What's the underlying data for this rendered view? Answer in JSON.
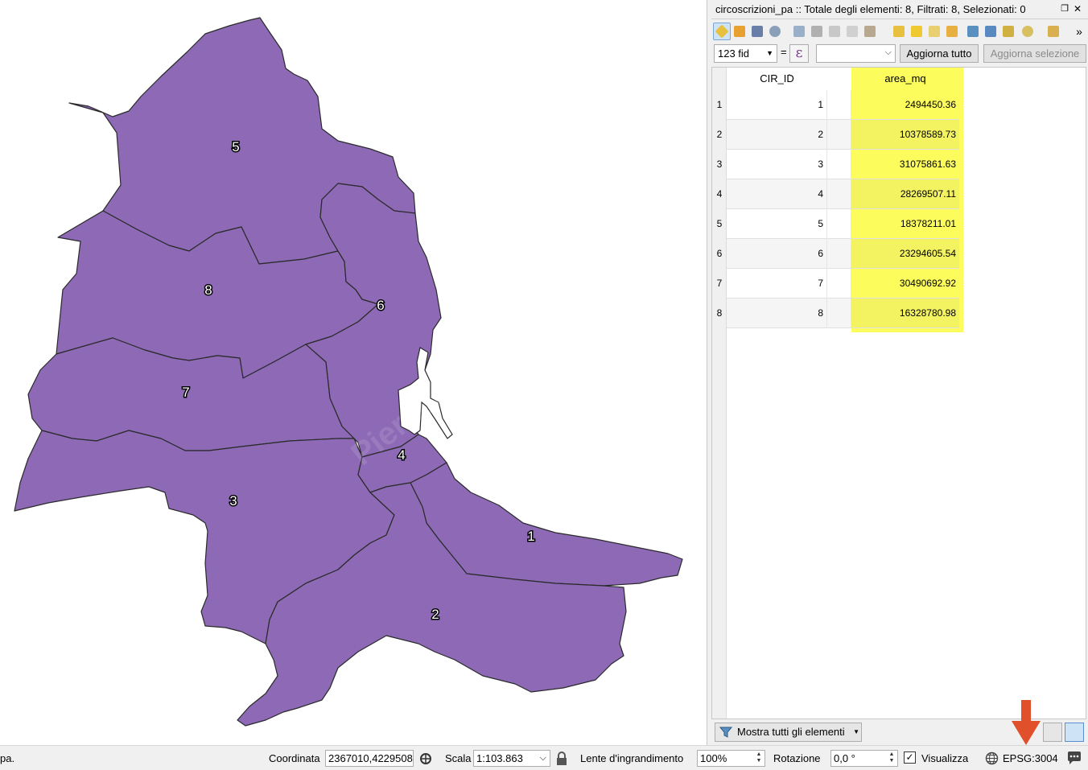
{
  "map": {
    "fill_color": "#8d69b6",
    "stroke_color": "#2a2a2a",
    "labels": [
      "1",
      "2",
      "3",
      "4",
      "5",
      "6",
      "7",
      "8"
    ],
    "watermark": "Pierecoinfinito"
  },
  "attribute_table": {
    "title": "circoscrizioni_pa :: Totale degli elementi: 8, Filtrati: 8, Selezionati: 0",
    "toolbar_icons": [
      "pencil-icon",
      "multi-edit-icon",
      "save-icon",
      "reload-icon",
      "add-feature-icon",
      "delete-icon",
      "cut-icon",
      "copy-icon",
      "paste-icon",
      "select-expression-icon",
      "select-all-icon",
      "invert-selection-icon",
      "deselect-icon",
      "filter-map-icon",
      "move-selection-top-icon",
      "pan-map-icon",
      "zoom-map-icon",
      "new-field-icon",
      "more-icon"
    ],
    "field_select": "123 fid",
    "equals": "=",
    "expression_symbol": "ε",
    "value_select": "",
    "update_all": "Aggiorna tutto",
    "update_selection": "Aggiorna selezione",
    "columns": [
      "CIR_ID",
      "area_mq"
    ],
    "rows": [
      {
        "n": "1",
        "cir_id": "1",
        "area": "2494450.36"
      },
      {
        "n": "2",
        "cir_id": "2",
        "area": "10378589.73"
      },
      {
        "n": "3",
        "cir_id": "3",
        "area": "31075861.63"
      },
      {
        "n": "4",
        "cir_id": "4",
        "area": "28269507.11"
      },
      {
        "n": "5",
        "cir_id": "5",
        "area": "18378211.01"
      },
      {
        "n": "6",
        "cir_id": "6",
        "area": "23294605.54"
      },
      {
        "n": "7",
        "cir_id": "7",
        "area": "30490692.92"
      },
      {
        "n": "8",
        "cir_id": "8",
        "area": "16328780.98"
      }
    ],
    "highlight_color": "#fcfc5c",
    "show_all": "Mostra tutti gli elementi"
  },
  "statusbar": {
    "left_text": "pa.",
    "coord_label": "Coordinata",
    "coord_value": "2367010,4229508",
    "scale_label": "Scala",
    "scale_value": "1:103.863",
    "magnifier_label": "Lente d'ingrandimento",
    "magnifier_value": "100%",
    "rotation_label": "Rotazione",
    "rotation_value": "0,0 °",
    "render_label": "Visualizza",
    "render_checked": "✓",
    "crs": "EPSG:3004"
  },
  "annotation_color": "#e0502a"
}
